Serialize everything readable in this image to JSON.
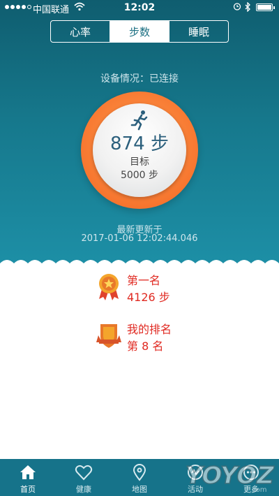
{
  "status_bar": {
    "carrier": "中国联通",
    "time": "12:02"
  },
  "segments": [
    {
      "label": "心率",
      "active": false
    },
    {
      "label": "步数",
      "active": true
    },
    {
      "label": "睡眠",
      "active": false
    }
  ],
  "device_status": "设备情况：已连接",
  "steps": {
    "count_text": "874 步",
    "goal_label": "目标",
    "goal_value": "5000 步"
  },
  "updated": {
    "label": "最新更新于",
    "timestamp": "2017-01-06 12:02:44.046"
  },
  "ranking": {
    "first_title": "第一名",
    "first_steps": "4126 步",
    "mine_title": "我的排名",
    "mine_rank": "第 8 名"
  },
  "tabs": [
    {
      "label": "首页",
      "icon": "home-icon"
    },
    {
      "label": "健康",
      "icon": "heart-icon"
    },
    {
      "label": "地图",
      "icon": "map-pin-icon"
    },
    {
      "label": "活动",
      "icon": "activity-icon"
    },
    {
      "label": "更多",
      "icon": "more-icon"
    }
  ],
  "watermark": "YOYOZ.com",
  "colors": {
    "header_bg": "#16788c",
    "ring_orange": "#f7762f",
    "rank_red": "#e02a22",
    "tabbar_bg": "#16738a"
  }
}
